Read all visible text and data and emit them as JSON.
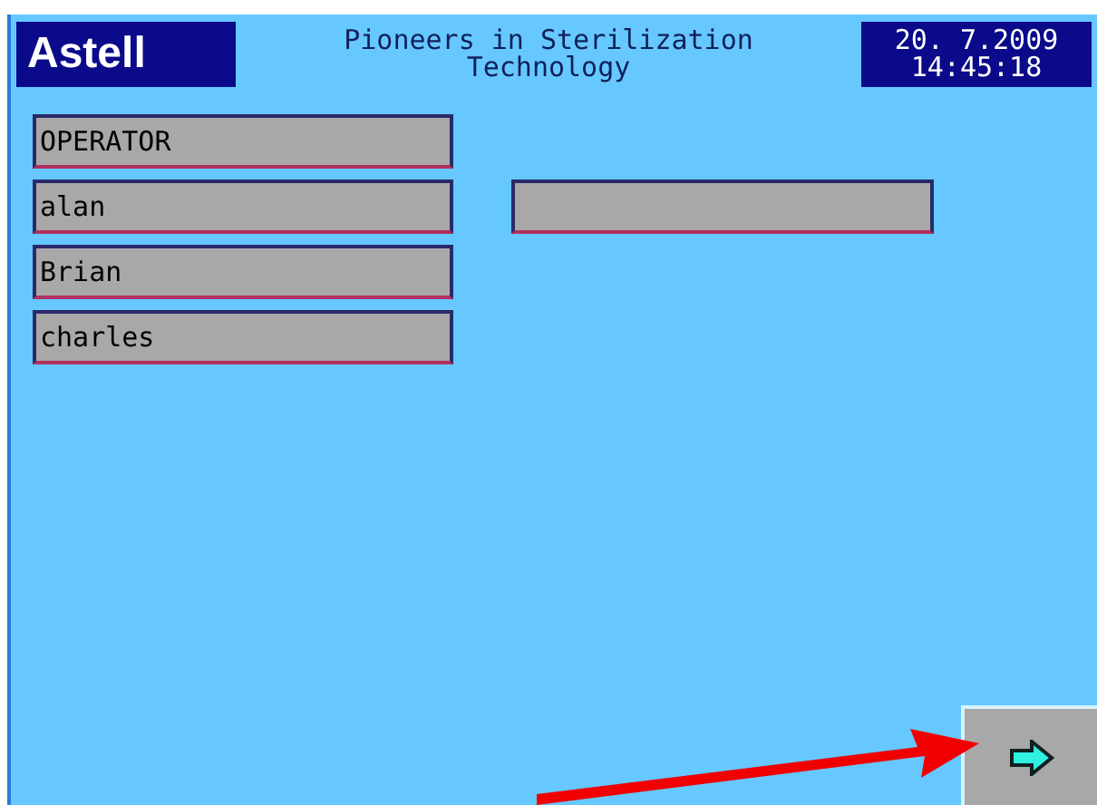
{
  "header": {
    "logo": "Astell",
    "tagline_1": "Pioneers in Sterilization",
    "tagline_2": "Technology",
    "date": "20. 7.2009",
    "time": "14:45:18"
  },
  "operators": [
    {
      "label": "OPERATOR"
    },
    {
      "label": "alan"
    },
    {
      "label": "Brian"
    },
    {
      "label": "charles"
    }
  ]
}
